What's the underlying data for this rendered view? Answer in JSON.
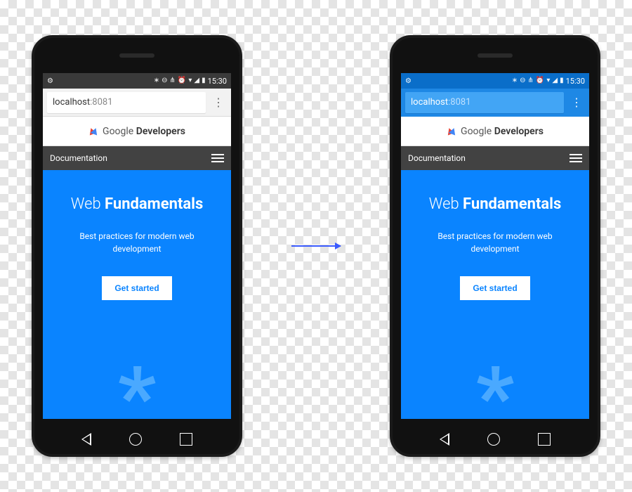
{
  "status": {
    "time": "15:30",
    "icons": [
      "bluetooth",
      "do-not-disturb",
      "vibrate",
      "alarm",
      "wifi",
      "signal",
      "battery-charging"
    ]
  },
  "browser": {
    "url_host": "localhost",
    "url_port": ":8081",
    "menu_glyph": "⋮"
  },
  "logo": {
    "brand_light": "Google",
    "brand_bold": "Developers"
  },
  "doc_header": {
    "title": "Documentation"
  },
  "hero": {
    "title_light": "Web ",
    "title_bold": "Fundamentals",
    "subtitle": "Best practices for modern web development",
    "cta": "Get started",
    "decoration": "*"
  },
  "theme": {
    "default_chrome": "#f2f2f2",
    "themed_chrome": "#1e88e5",
    "hero_bg": "#0a84ff"
  }
}
